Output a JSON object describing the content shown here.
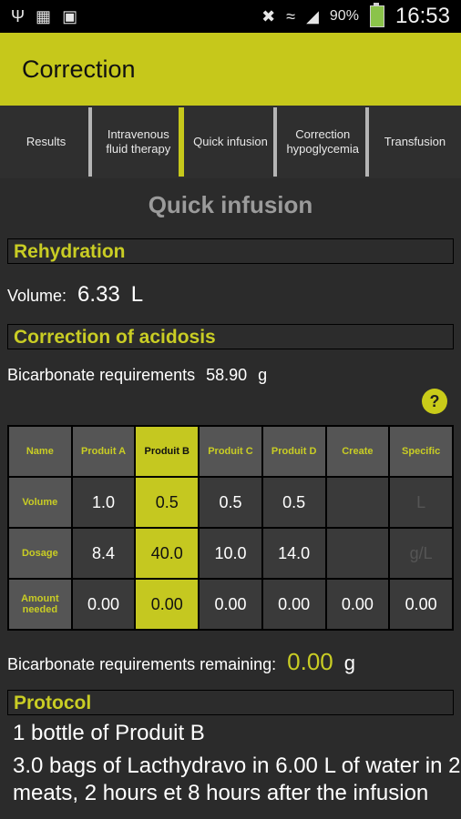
{
  "status": {
    "battery": "90%",
    "time": "16:53"
  },
  "app_title": "Correction",
  "tabs": [
    "Results",
    "Intravenous fluid therapy",
    "Quick infusion",
    "Correction hypoglycemia",
    "Transfusion"
  ],
  "screen_title": "Quick infusion",
  "rehydration": {
    "header": "Rehydration",
    "label": "Volume:",
    "value": "6.33",
    "unit": "L"
  },
  "acidosis": {
    "header": "Correction of acidosis",
    "label": "Bicarbonate requirements",
    "value": "58.90",
    "unit": "g",
    "help": "?"
  },
  "table": {
    "headers": [
      "Name",
      "Produit A",
      "Produit B",
      "Produit C",
      "Produit D",
      "Create",
      "Specific"
    ],
    "rows": [
      {
        "label": "Volume",
        "cells": [
          "1.0",
          "0.5",
          "0.5",
          "0.5",
          "",
          "L"
        ]
      },
      {
        "label": "Dosage",
        "cells": [
          "8.4",
          "40.0",
          "10.0",
          "14.0",
          "",
          "g/L"
        ]
      },
      {
        "label": "Amount needed",
        "cells": [
          "0.00",
          "0.00",
          "0.00",
          "0.00",
          "0.00",
          "0.00"
        ]
      }
    ]
  },
  "remaining": {
    "label": "Bicarbonate requirements remaining:",
    "value": "0.00",
    "unit": "g"
  },
  "protocol": {
    "header": "Protocol",
    "lines": [
      "1 bottle of Produit B",
      "3.0 bags of Lacthydravo in 6.00 L of water in 2 meats, 2 hours et 8 hours after the infusion"
    ]
  }
}
